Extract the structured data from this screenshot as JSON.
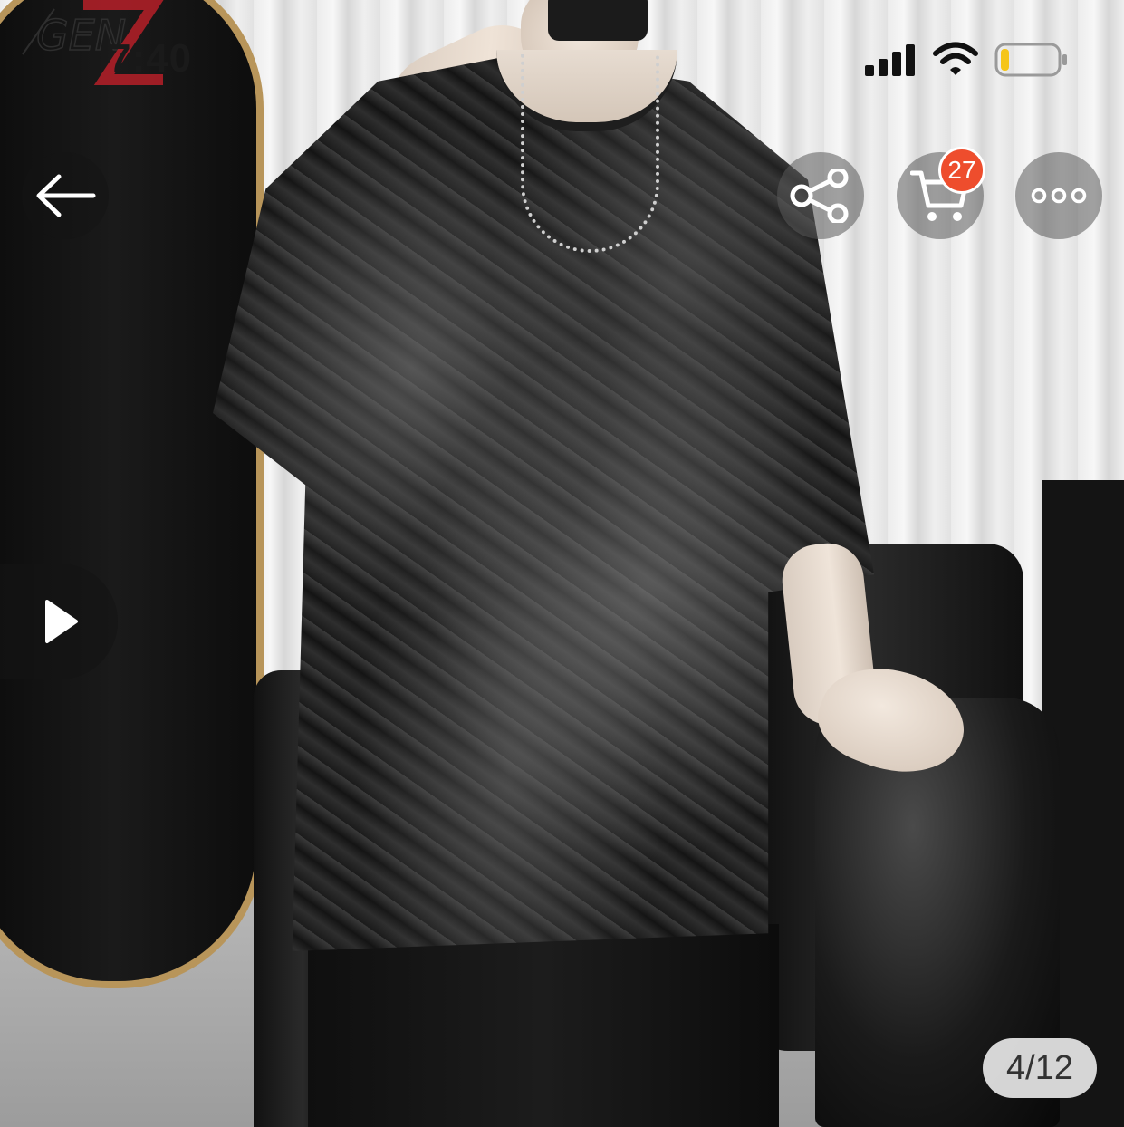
{
  "status_bar": {
    "time": "7:40",
    "signal_bars": 4,
    "battery_level": 0.15,
    "battery_color": "#f5c518"
  },
  "header": {
    "back_icon": "arrow-left-icon",
    "share_icon": "share-icon",
    "cart_icon": "cart-icon",
    "cart_count": "27",
    "more_icon": "more-dots-icon"
  },
  "media": {
    "play_icon": "play-icon",
    "page_counter": "4/12"
  },
  "colors": {
    "badge": "#ee4d2d",
    "overlay_button": "#5a5a5a"
  }
}
